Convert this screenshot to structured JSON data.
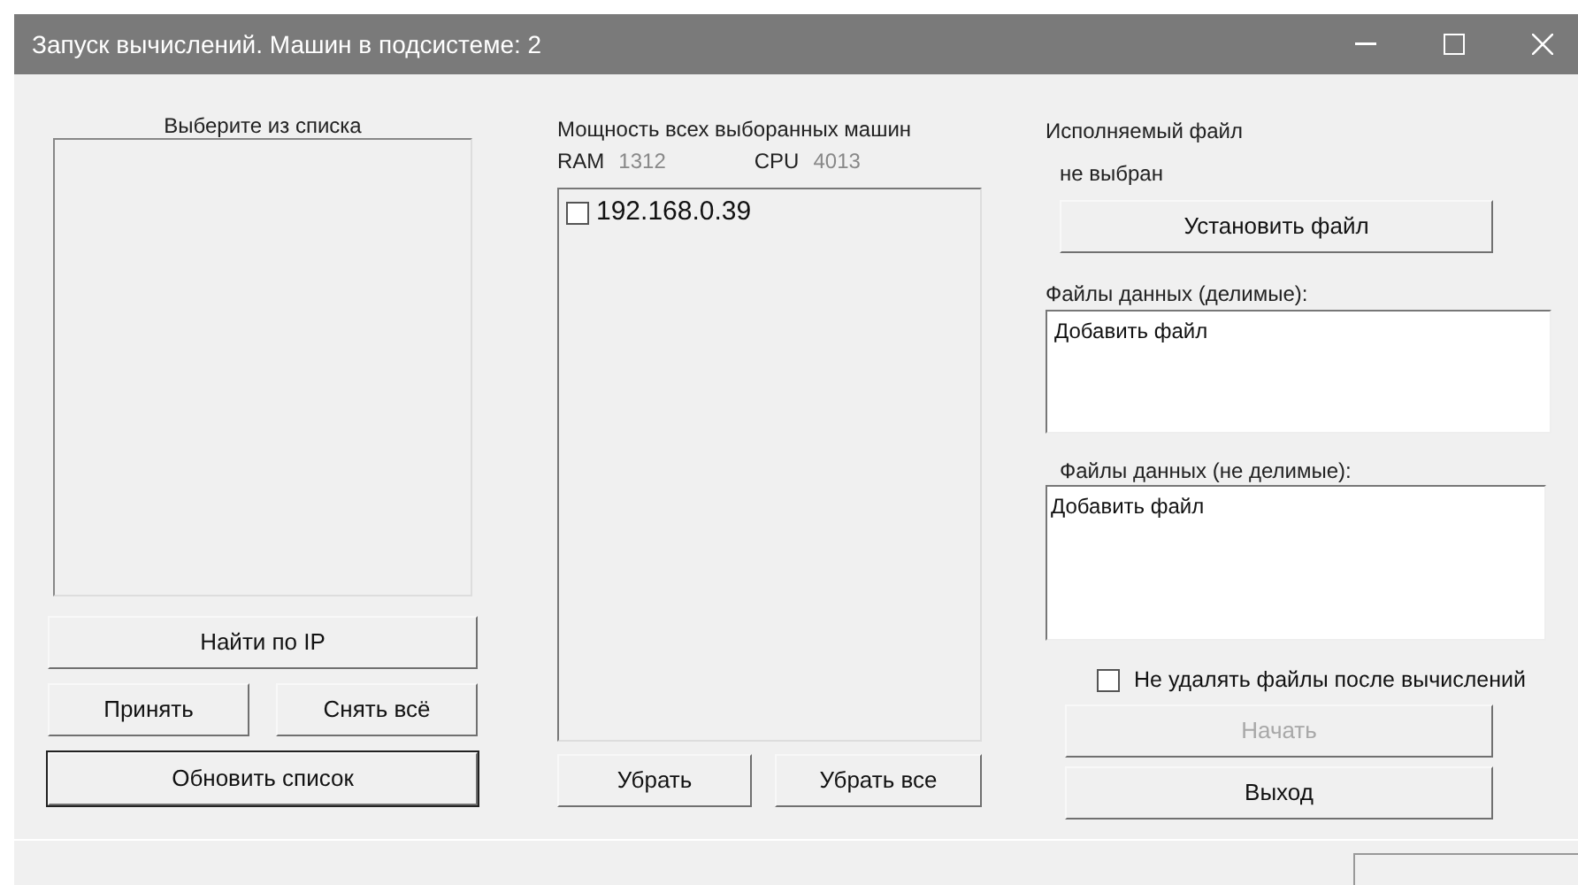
{
  "window": {
    "title": "Запуск вычислений. Машин в подсистеме: 2"
  },
  "left": {
    "label": "Выберите из списка",
    "find_button": "Найти по IP",
    "accept_button": "Принять",
    "clear_button": "Снять всё",
    "refresh_button": "Обновить список"
  },
  "middle": {
    "label": "Мощность всех выборанных машин",
    "ram_label": "RAM",
    "ram_value": "1312",
    "cpu_label": "CPU",
    "cpu_value": "4013",
    "machines": [
      {
        "address": "192.168.0.39",
        "checked": false
      }
    ],
    "remove_button": "Убрать",
    "remove_all_button": "Убрать все"
  },
  "right": {
    "exe_label": "Исполняемый файл",
    "exe_value": "не выбран",
    "set_file_button": "Установить файл",
    "divisible_label": "Файлы данных (делимые):",
    "divisible_items": [
      "Добавить файл"
    ],
    "nondivisible_label": "Файлы данных (не делимые):",
    "nondivisible_items": [
      "Добавить файл"
    ],
    "keep_files": {
      "label": "Не удалять файлы после вычислений",
      "checked": false
    },
    "start_button": {
      "label": "Начать",
      "disabled": true
    },
    "exit_button": {
      "label": "Выход",
      "disabled": false
    }
  }
}
